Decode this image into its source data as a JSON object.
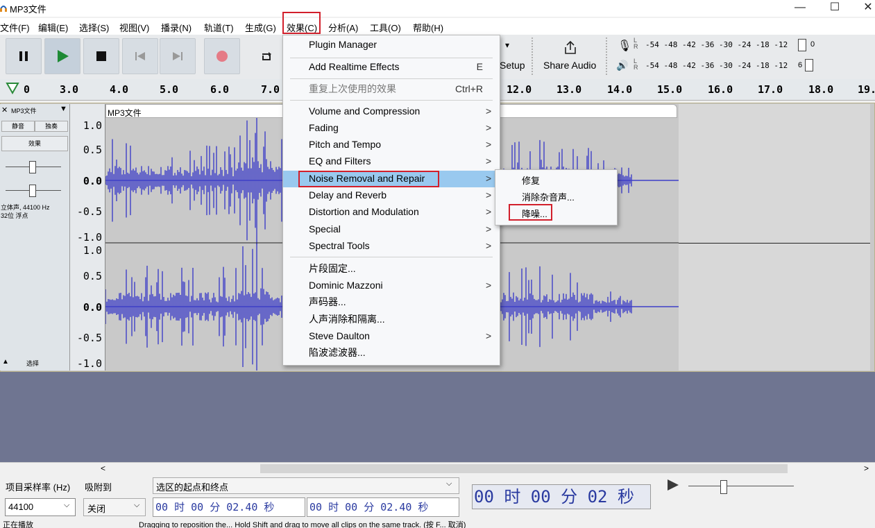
{
  "window": {
    "title": "MP3文件",
    "minimize": "—",
    "maximize": "☐",
    "close": "✕"
  },
  "menubar": [
    "文件(F)",
    "编辑(E)",
    "选择(S)",
    "视图(V)",
    "播录(N)",
    "轨道(T)",
    "生成(G)",
    "效果(C)",
    "分析(A)",
    "工具(O)",
    "帮助(H)"
  ],
  "toolbar": {
    "setup_label": "Setup",
    "share_label": "Share Audio",
    "meter_ticks": "-54 -48 -42 -36 -30 -24 -18 -12",
    "meter_end1": "0",
    "meter_end2": "6"
  },
  "ruler": [
    "0",
    "3.0",
    "4.0",
    "5.0",
    "6.0",
    "7.0",
    "12.0",
    "13.0",
    "14.0",
    "15.0",
    "16.0",
    "17.0",
    "18.0",
    "19."
  ],
  "track": {
    "name": "MP3文件",
    "clip_title": "MP3文件",
    "mute": "静音",
    "solo": "独奏",
    "effects": "效果",
    "info1": "立体声, 44100 Hz",
    "info2": "32位 浮点",
    "select": "选择",
    "scale_top": [
      "1.0",
      "0.5",
      "0.0",
      "-0.5",
      "-1.0"
    ],
    "scale_bottom": [
      "1.0",
      "0.5",
      "0.0",
      "-0.5",
      "-1.0"
    ]
  },
  "menu": {
    "items": [
      {
        "label": "Plugin Manager",
        "shortcut": "",
        "arrow": ""
      },
      {
        "label": "Add Realtime Effects",
        "shortcut": "E",
        "arrow": ""
      },
      {
        "label": "重复上次使用的效果",
        "shortcut": "Ctrl+R",
        "arrow": ""
      },
      {
        "label": "Volume and Compression",
        "shortcut": "",
        "arrow": ">"
      },
      {
        "label": "Fading",
        "shortcut": "",
        "arrow": ">"
      },
      {
        "label": "Pitch and Tempo",
        "shortcut": "",
        "arrow": ">"
      },
      {
        "label": "EQ and Filters",
        "shortcut": "",
        "arrow": ">"
      },
      {
        "label": "Noise Removal and Repair",
        "shortcut": "",
        "arrow": ">"
      },
      {
        "label": "Delay and Reverb",
        "shortcut": "",
        "arrow": ">"
      },
      {
        "label": "Distortion and Modulation",
        "shortcut": "",
        "arrow": ">"
      },
      {
        "label": "Special",
        "shortcut": "",
        "arrow": ">"
      },
      {
        "label": "Spectral Tools",
        "shortcut": "",
        "arrow": ">"
      },
      {
        "label": "片段固定...",
        "shortcut": "",
        "arrow": ""
      },
      {
        "label": "Dominic Mazzoni",
        "shortcut": "",
        "arrow": ">"
      },
      {
        "label": "声码器...",
        "shortcut": "",
        "arrow": ""
      },
      {
        "label": "人声消除和隔离...",
        "shortcut": "",
        "arrow": ""
      },
      {
        "label": "Steve Daulton",
        "shortcut": "",
        "arrow": ">"
      },
      {
        "label": "陷波滤波器...",
        "shortcut": "",
        "arrow": ""
      }
    ],
    "submenu": [
      "修复",
      "消除杂音声...",
      "降噪..."
    ]
  },
  "bottom": {
    "rate_label": "项目采样率 (Hz)",
    "snap_label": "吸附到",
    "rate_value": "44100",
    "snap_value": "关闭",
    "sel_label": "选区的起点和终点",
    "time1": "00 时 00 分 02.40 秒",
    "time2": "00 时 00 分 02.40 秒",
    "big_time": "00 时 00 分 02 秒",
    "scroll_left": "<",
    "scroll_right": ">"
  },
  "status": {
    "left": "正在播放",
    "right": "Dragging to reposition the... Hold Shift and drag to move all clips on the same track. (按 F... 取消)"
  },
  "colors": {
    "wave": "#3e3fc7",
    "highlight": "#99c9ef",
    "accent_red": "#d21f2b"
  }
}
